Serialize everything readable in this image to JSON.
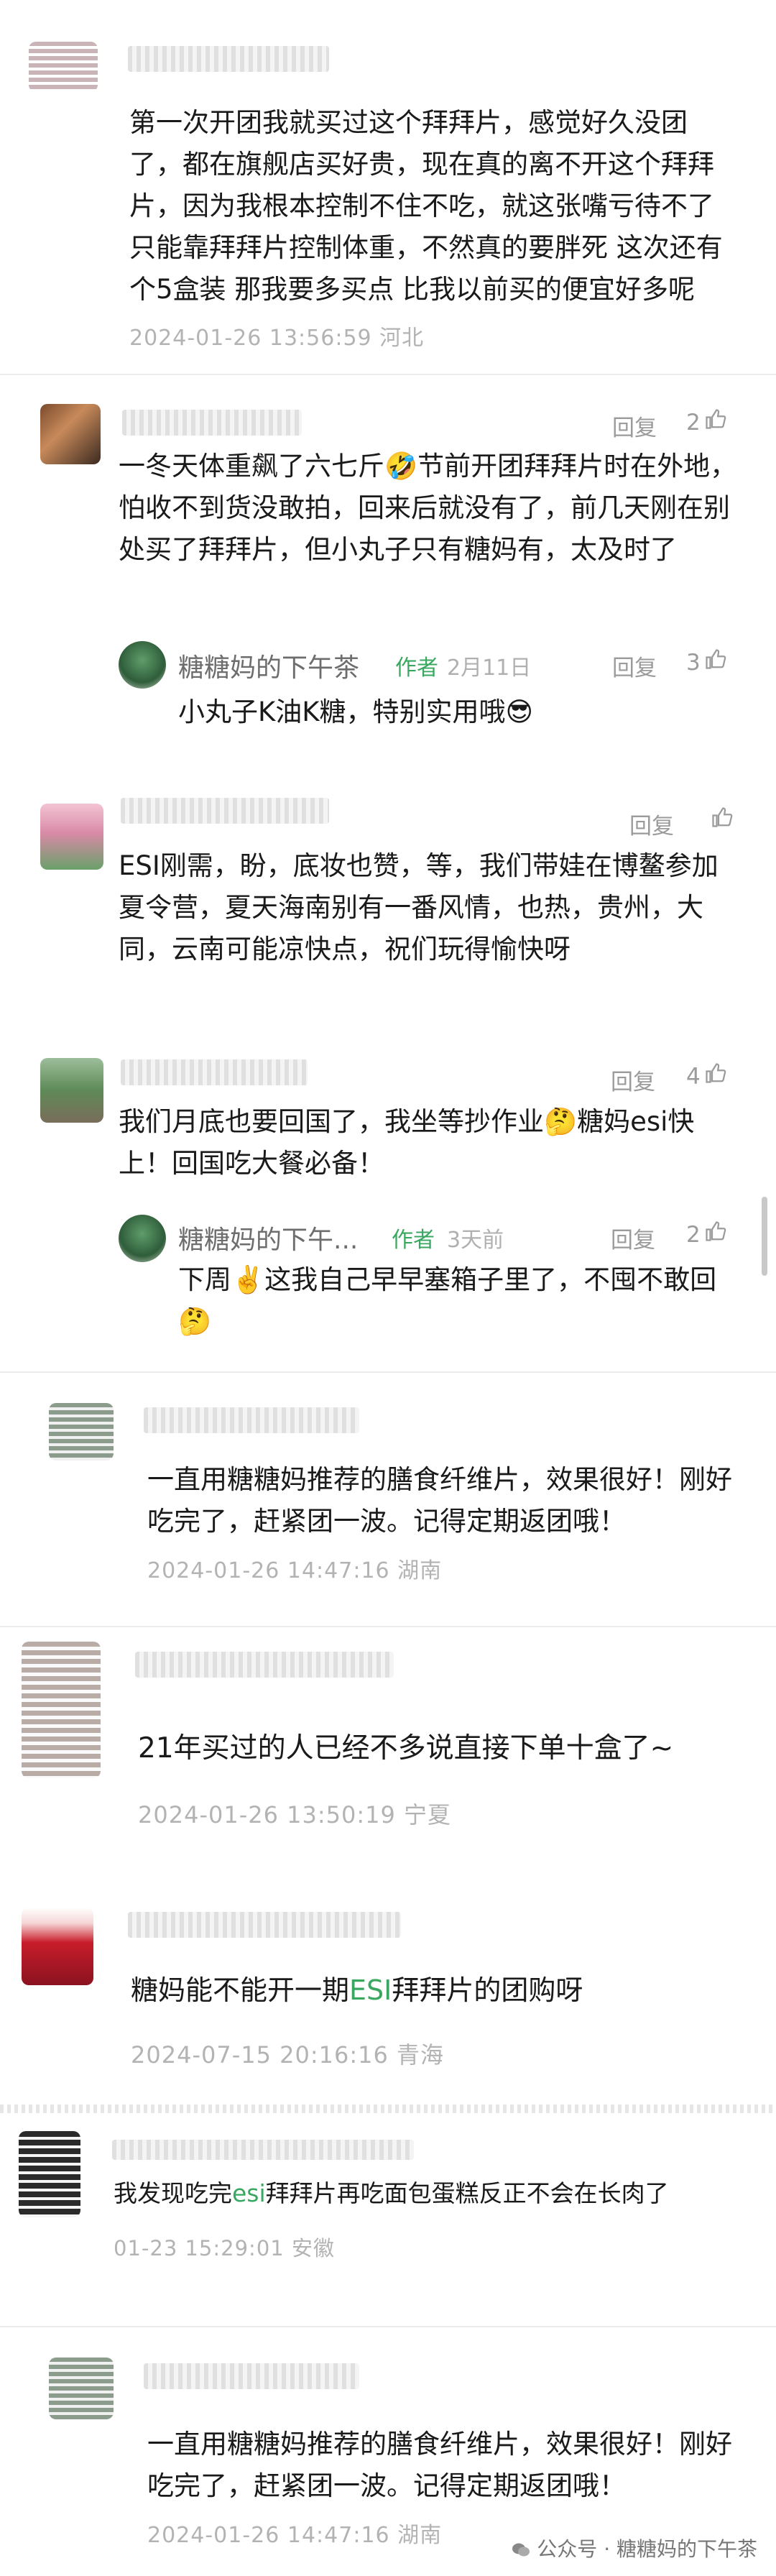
{
  "comments": [
    {
      "text": "第一次开团我就买过这个拜拜片，感觉好久没团了，都在旗舰店买好贵，现在真的离不开这个拜拜片，因为我根本控制不住不吃，就这张嘴亏待不了 只能靠拜拜片控制体重，不然真的要胖死 这次还有个5盒装 那我要多买点 比我以前买的便宜好多呢",
      "meta": "2024-01-26 13:56:59 河北"
    },
    {
      "reply_label": "回复",
      "likes": "2",
      "text": "一冬天体重飙了六七斤🤣节前开团拜拜片时在外地，怕收不到货没敢拍，回来后就没有了，前几天刚在别处买了拜拜片，但小丸子只有糖妈有，太及时了",
      "author": {
        "name": "糖糖妈的下午茶",
        "tag": "作者",
        "date": "2月11日",
        "reply_label": "回复",
        "likes": "3",
        "text": "小丸子K油K糖，特别实用哦😎"
      }
    },
    {
      "reply_label": "回复",
      "text": "ESI刚需，盼，底妆也赞，等，我们带娃在博鳌参加夏令营，夏天海南别有一番风情，也热，贵州，大同，云南可能凉快点，祝们玩得愉快呀"
    },
    {
      "reply_label": "回复",
      "likes": "4",
      "text": "我们月底也要回国了，我坐等抄作业🤔糖妈esi快上！回国吃大餐必备！",
      "author": {
        "name": "糖糖妈的下午...",
        "tag": "作者",
        "date": "3天前",
        "reply_label": "回复",
        "likes": "2",
        "text": "下周✌️这我自己早早塞箱子里了，不囤不敢回🤔"
      }
    },
    {
      "text": "一直用糖糖妈推荐的膳食纤维片，效果很好！刚好吃完了，赶紧团一波。记得定期返团哦！",
      "meta": "2024-01-26 14:47:16 湖南"
    },
    {
      "text": "21年买过的人已经不多说直接下单十盒了~",
      "meta": "2024-01-26 13:50:19 宁夏"
    },
    {
      "text_a": "糖妈能不能开一期",
      "text_hl": "ESI",
      "text_b": "拜拜片的团购呀",
      "meta": "2024-07-15 20:16:16 青海"
    },
    {
      "text_a": "我发现吃完",
      "text_hl": "esi",
      "text_b": "拜拜片再吃面包蛋糕反正不会在长肉了",
      "meta": "01-23 15:29:01 安徽"
    },
    {
      "text": "一直用糖糖妈推荐的膳食纤维片，效果很好！刚好吃完了，赶紧团一波。记得定期返团哦！",
      "meta": "2024-01-26 14:47:16 湖南"
    }
  ],
  "watermark": "公众号 · 糖糖妈的下午茶",
  "icons": {
    "thumb": "thumbs-up-icon",
    "wechat": "wechat-icon"
  }
}
